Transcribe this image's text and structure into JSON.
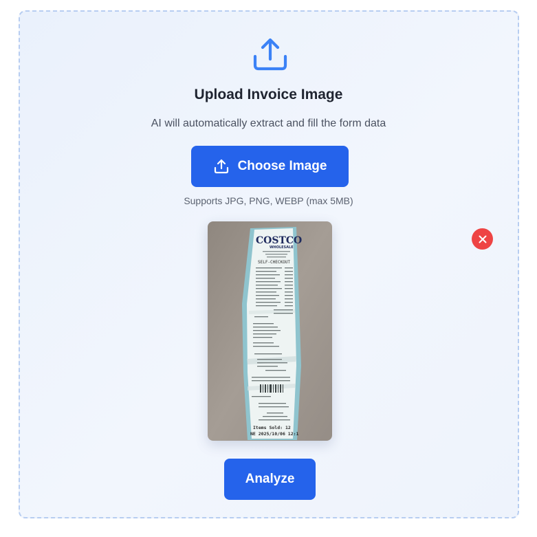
{
  "upload_panel": {
    "title": "Upload Invoice Image",
    "subtitle": "AI will automatically extract and fill the form data",
    "choose_button_label": "Choose Image",
    "supported_formats_hint": "Supports JPG, PNG, WEBP (max 5MB)",
    "analyze_button_label": "Analyze",
    "icons": {
      "header": "upload-icon",
      "choose_button": "upload-icon",
      "remove_preview": "close-icon"
    }
  },
  "preview_image": {
    "store_logo": "COSTCO",
    "store_logo_sub": "WHOLESALE",
    "header_line": "SELF-CHECKOUT",
    "items_sold_line": "Items Sold: 12",
    "date_line": "NE 2025/10/06 12:1"
  },
  "colors": {
    "accent": "#2563eb",
    "remove": "#ee4444",
    "panel_border": "#b7cdf1",
    "panel_background": "#eef3fc"
  }
}
